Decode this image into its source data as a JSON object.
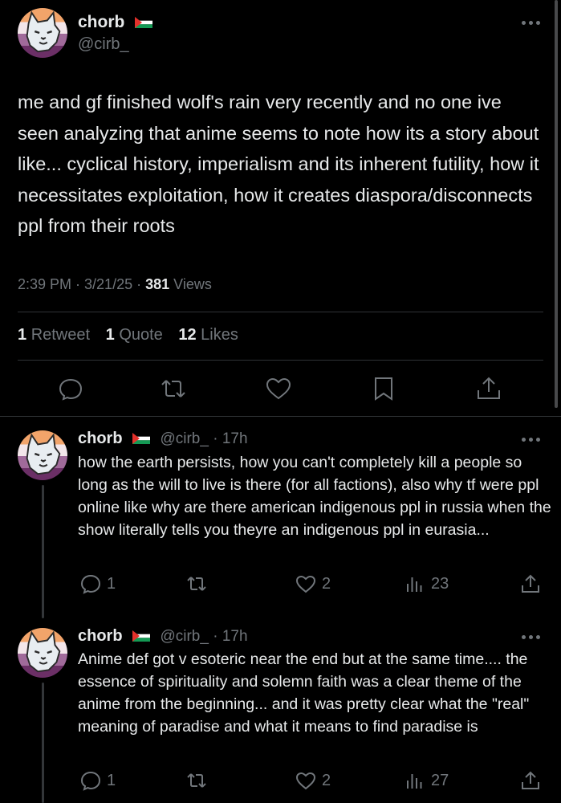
{
  "main": {
    "name": "chorb",
    "handle": "@cirb_",
    "text": "me and gf finished wolf's rain very recently and no one ive seen analyzing that anime seems to note how its a story about like... cyclical history, imperialism and its inherent futility, how it necessitates exploitation, how it creates diaspora/disconnects ppl from their roots",
    "time": "2:39 PM · 3/21/25 · ",
    "views_count": "381",
    "views_label": " Views",
    "retweets_count": "1",
    "retweets_label": "Retweet",
    "quotes_count": "1",
    "quotes_label": "Quote",
    "likes_count": "12",
    "likes_label": "Likes"
  },
  "replies": [
    {
      "name": "chorb",
      "handle_time": "@cirb_ · 17h",
      "text": "how the earth persists, how you can't completely kill a people so long as the will to live is there (for all factions), also why tf were ppl online like why are there american indigenous ppl in russia when the show literally tells you theyre an indigenous ppl in eurasia...",
      "replies": "1",
      "likes": "2",
      "views": "23"
    },
    {
      "name": "chorb",
      "handle_time": "@cirb_ · 17h",
      "text": "Anime def got v esoteric near the end but at the same time.... the essence of spirituality and solemn faith was a clear theme of the anime from the beginning... and it was pretty clear what the \"real\" meaning of paradise and what it means to find paradise is",
      "replies": "1",
      "likes": "2",
      "views": "27"
    }
  ],
  "colors": {
    "background": "#000000",
    "text": "#e7e9ea",
    "muted": "#71767b",
    "divider": "#2f3336"
  },
  "icons": [
    "reply-icon",
    "retweet-icon",
    "like-icon",
    "bookmark-icon",
    "share-icon",
    "views-icon",
    "more-icon",
    "palestine-flag-icon"
  ]
}
